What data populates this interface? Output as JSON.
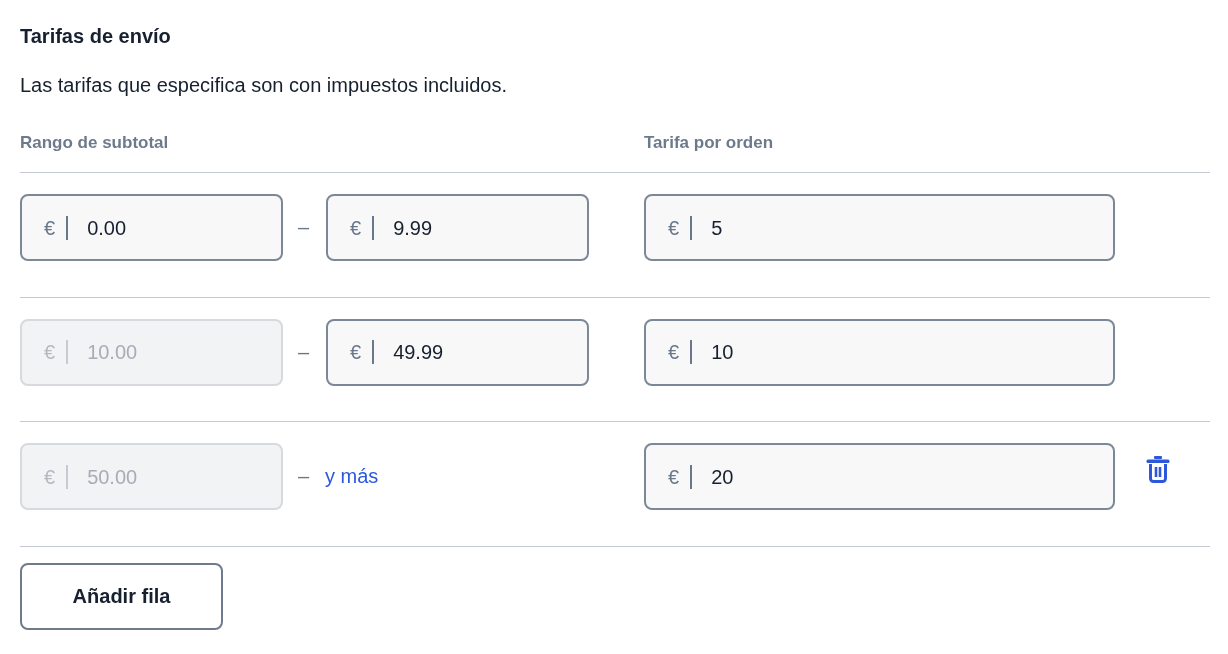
{
  "section": {
    "title": "Tarifas de envío",
    "description": "Las tarifas que especifica son con impuestos incluidos."
  },
  "columns": [
    "Rango de subtotal",
    "Tarifa por orden"
  ],
  "rows": [
    {
      "from": {
        "prefix": "€",
        "value": "0.00",
        "disabled": false
      },
      "separator": "–",
      "to": {
        "kind": "input",
        "prefix": "€",
        "value": "9.99",
        "disabled": false
      },
      "rate": {
        "prefix": "€",
        "value": "5",
        "disabled": false
      },
      "deletable": false
    },
    {
      "from": {
        "prefix": "€",
        "value": "10.00",
        "disabled": true
      },
      "separator": "–",
      "to": {
        "kind": "input",
        "prefix": "€",
        "value": "49.99",
        "disabled": false
      },
      "rate": {
        "prefix": "€",
        "value": "10",
        "disabled": false
      },
      "deletable": false
    },
    {
      "from": {
        "prefix": "€",
        "value": "50.00",
        "disabled": true
      },
      "separator": "–",
      "to": {
        "kind": "text",
        "label": "y más"
      },
      "rate": {
        "prefix": "€",
        "value": "20",
        "disabled": false
      },
      "deletable": true
    }
  ],
  "add_button": "Añadir fila"
}
